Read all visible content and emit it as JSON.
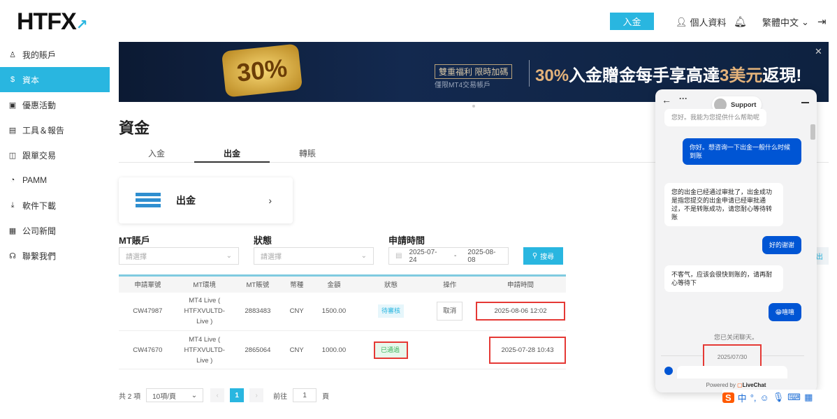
{
  "header": {
    "logo": "HTFX",
    "deposit": "入金",
    "profile": "個人資料",
    "language": "繁體中文"
  },
  "sidebar": {
    "items": [
      {
        "label": "我的賬戶",
        "icon": "user-icon"
      },
      {
        "label": "資本",
        "icon": "dollar-icon",
        "active": true
      },
      {
        "label": "優惠活動",
        "icon": "gift-icon"
      },
      {
        "label": "工具＆報告",
        "icon": "book-icon"
      },
      {
        "label": "跟單交易",
        "icon": "copy-icon"
      },
      {
        "label": "PAMM",
        "icon": "pie-icon"
      },
      {
        "label": "軟件下載",
        "icon": "download-icon"
      },
      {
        "label": "公司新聞",
        "icon": "news-icon"
      },
      {
        "label": "聯繫我們",
        "icon": "headset-icon"
      }
    ]
  },
  "banner": {
    "badge": "30%",
    "tag": "雙重福利 限時加碼",
    "sub": "僅限MT4交易帳戶",
    "main_a": "30%",
    "main_b": "入金贈金每手享高達",
    "main_c": "3美元",
    "main_d": "返現!"
  },
  "page": {
    "title": "資金",
    "tabs": [
      "入金",
      "出金",
      "轉賬"
    ],
    "card_label": "出金"
  },
  "filters": {
    "account_label": "MT賬戶",
    "account_placeholder": "請選擇",
    "status_label": "狀態",
    "status_placeholder": "請選擇",
    "time_label": "申請時間",
    "date_from": "2025-07-24",
    "date_sep": "-",
    "date_to": "2025-08-08",
    "search": "搜尋"
  },
  "table": {
    "headers": [
      "申請單號",
      "MT環境",
      "MT賬號",
      "幣種",
      "金額",
      "狀態",
      "操作",
      "申請時間"
    ],
    "rows": [
      {
        "id": "CW47987",
        "env": "MT4 Live ( HTFXVULTD-Live )",
        "account": "2883483",
        "currency": "CNY",
        "amount": "1500.00",
        "status": "待審核",
        "action": "取消",
        "time": "2025-08-06 12:02"
      },
      {
        "id": "CW47670",
        "env": "MT4 Live ( HTFXVULTD-Live )",
        "account": "2865064",
        "currency": "CNY",
        "amount": "1000.00",
        "status": "已通過",
        "action": "",
        "time": "2025-07-28 10:43"
      }
    ]
  },
  "pagination": {
    "total": "共 2 項",
    "page_size": "10項/頁",
    "current": "1",
    "goto": "前往",
    "goto_value": "1",
    "page_unit": "頁"
  },
  "export_partial": "出",
  "chat": {
    "agent": "Support",
    "messages": [
      {
        "from": "agent",
        "text": "您好。我能为您提供什么帮助呢"
      },
      {
        "from": "me",
        "text": "你好。想咨询一下出金一般什么时候到账"
      },
      {
        "from": "agent",
        "text": "您的出金已经通过审批了，出金成功是指您提交的出金申请已经审批通过，不是转账成功，请您耐心等待转账"
      },
      {
        "from": "me",
        "text": "好的谢谢"
      },
      {
        "from": "agent",
        "text": "不客气，应该会很快到账的，请再耐心等待下"
      },
      {
        "from": "me",
        "text": "😁嘻嘻"
      }
    ],
    "closed": "您已关闭聊天。",
    "date": "2025/07/30",
    "powered": "Powered by",
    "brand": "LiveChat"
  },
  "ime": {
    "label": "中"
  }
}
